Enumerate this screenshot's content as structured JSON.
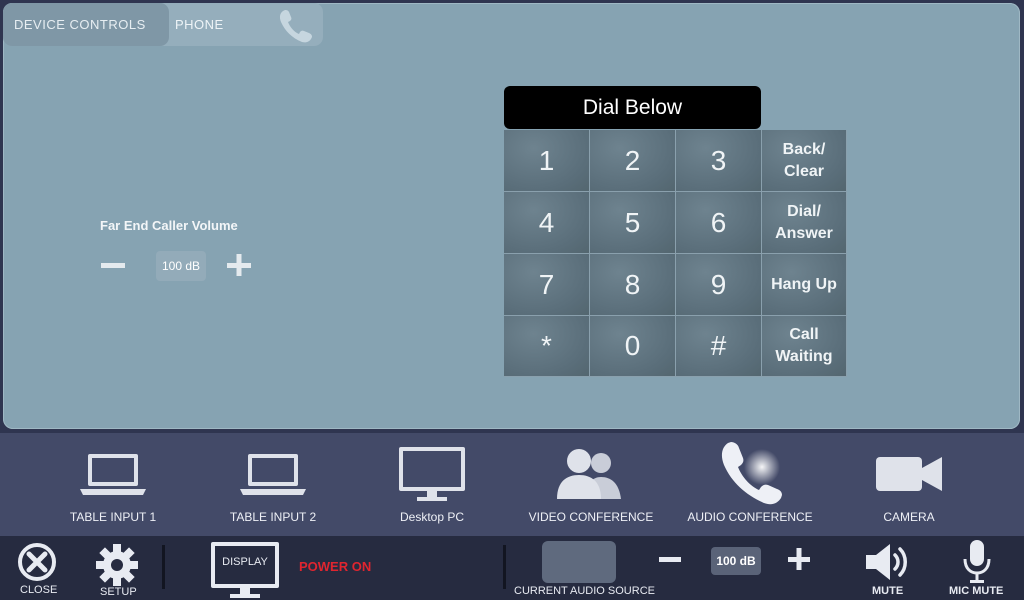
{
  "tabs": {
    "device_controls": "DEVICE CONTROLS",
    "phone": "PHONE"
  },
  "volume": {
    "label": "Far End Caller Volume",
    "value": "100 dB"
  },
  "dialer": {
    "title": "Dial Below",
    "keys": [
      {
        "label": "1",
        "type": "digit"
      },
      {
        "label": "2",
        "type": "digit"
      },
      {
        "label": "3",
        "type": "digit"
      },
      {
        "label": "Back/\nClear",
        "type": "function"
      },
      {
        "label": "4",
        "type": "digit"
      },
      {
        "label": "5",
        "type": "digit"
      },
      {
        "label": "6",
        "type": "digit"
      },
      {
        "label": "Dial/\nAnswer",
        "type": "function"
      },
      {
        "label": "7",
        "type": "digit"
      },
      {
        "label": "8",
        "type": "digit"
      },
      {
        "label": "9",
        "type": "digit"
      },
      {
        "label": "Hang Up",
        "type": "function"
      },
      {
        "label": "*",
        "type": "digit"
      },
      {
        "label": "0",
        "type": "digit"
      },
      {
        "label": "#",
        "type": "digit"
      },
      {
        "label": "Call\nWaiting",
        "type": "function"
      }
    ]
  },
  "sources": [
    {
      "label": "TABLE INPUT 1",
      "icon": "laptop-icon"
    },
    {
      "label": "TABLE INPUT 2",
      "icon": "laptop-icon"
    },
    {
      "label": "Desktop PC",
      "icon": "monitor-icon"
    },
    {
      "label": "VIDEO CONFERENCE",
      "icon": "people-icon"
    },
    {
      "label": "AUDIO CONFERENCE",
      "icon": "phone-handset-icon"
    },
    {
      "label": "CAMERA",
      "icon": "video-camera-icon"
    }
  ],
  "bottom_bar": {
    "close_label": "CLOSE",
    "setup_label": "SETUP",
    "display_label": "DISPLAY",
    "power_status": "POWER ON",
    "current_source_label": "CURRENT AUDIO SOURCE",
    "audio_volume": "100 dB",
    "mute_label": "MUTE",
    "mic_mute_label": "MIC MUTE"
  },
  "colors": {
    "panel": "#86a3b2",
    "key": "#5a6e7a",
    "source_bar": "#434a68",
    "bottom_bar": "#262b40",
    "power_on": "#e0252f"
  }
}
